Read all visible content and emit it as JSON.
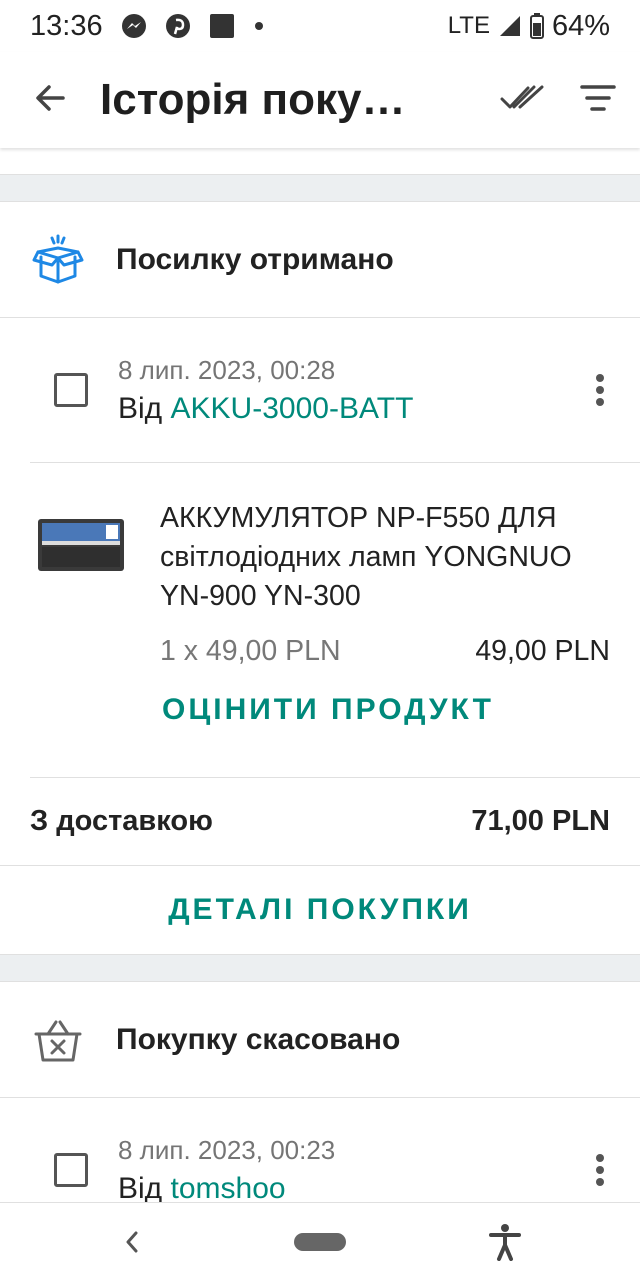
{
  "status_bar": {
    "time": "13:36",
    "network": "LTE",
    "battery": "64%",
    "icons": [
      "messenger-icon",
      "pinterest-icon",
      "square-notification-icon",
      "dot-icon",
      "signal-icon",
      "battery-icon"
    ]
  },
  "app_bar": {
    "title": "Історія поку…",
    "icons": [
      "back-arrow-icon",
      "mark-all-read-icon",
      "filter-icon"
    ]
  },
  "orders": [
    {
      "status": "Посилку отримано",
      "status_icon": "package-received-icon",
      "date": "8 лип. 2023, 00:28",
      "from_label": "Від",
      "seller": "AKKU-3000-BATT",
      "item": {
        "name": "АККУМУЛЯТОР NP-F550 ДЛЯ світлодіодних ламп YONGNUO YN-900 YN-300",
        "quantity_price": "1 x 49,00 PLN",
        "price": "49,00 PLN",
        "rate_label": "ОЦІНИТИ ПРОДУКТ"
      },
      "total_label": "З доставкою",
      "total": "71,00 PLN",
      "details_label": "ДЕТАЛІ ПОКУПКИ"
    },
    {
      "status": "Покупку скасовано",
      "status_icon": "basket-cancelled-icon",
      "date": "8 лип. 2023, 00:23",
      "from_label": "Від",
      "seller": "tomshoo"
    }
  ],
  "colors": {
    "accent": "#00897b",
    "status_icon_blue": "#1e88e5",
    "separator_bg": "#eceff1"
  }
}
